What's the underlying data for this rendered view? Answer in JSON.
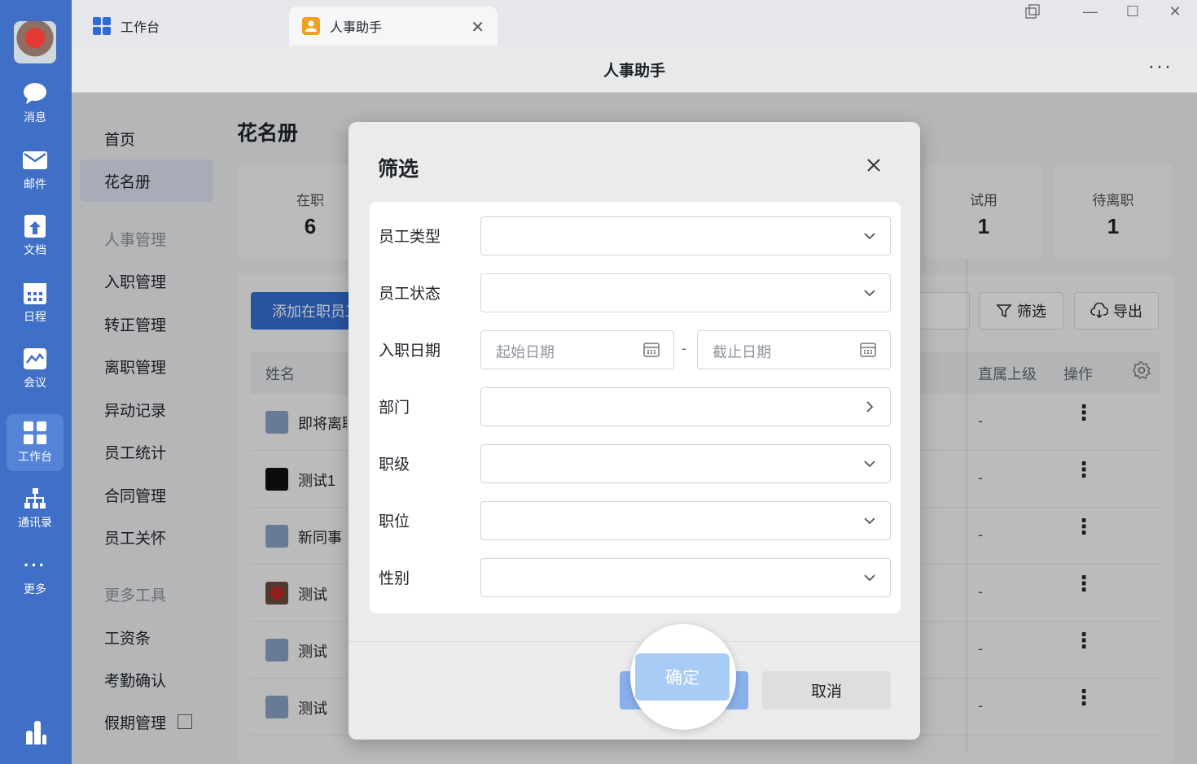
{
  "rail": {
    "items": [
      {
        "label": "消息",
        "icon": "chat-icon"
      },
      {
        "label": "邮件",
        "icon": "mail-icon"
      },
      {
        "label": "文档",
        "icon": "docs-icon"
      },
      {
        "label": "日程",
        "icon": "calendar-icon"
      },
      {
        "label": "会议",
        "icon": "meeting-icon"
      },
      {
        "label": "工作台",
        "icon": "workbench-icon",
        "active": true
      },
      {
        "label": "通讯录",
        "icon": "contacts-icon"
      },
      {
        "label": "更多",
        "icon": "more-icon"
      }
    ]
  },
  "tabs": {
    "tab1": "工作台",
    "tab2": "人事助手",
    "close": "✕"
  },
  "window": {
    "minimize": "—",
    "maximize": "☐",
    "close": "✕"
  },
  "header": {
    "title": "人事助手",
    "more": "···"
  },
  "sidenav": {
    "home": "首页",
    "roster": "花名册",
    "hr_group": "人事管理",
    "onboarding": "入职管理",
    "regularization": "转正管理",
    "offboarding": "离职管理",
    "changes": "异动记录",
    "stats": "员工统计",
    "contracts": "合同管理",
    "care": "员工关怀",
    "tools_group": "更多工具",
    "payslip": "工资条",
    "attendance": "考勤确认",
    "leave": "假期管理"
  },
  "main": {
    "title": "花名册",
    "stats": [
      {
        "label": "在职",
        "value": "6"
      },
      {
        "label": "试用",
        "value": "1"
      },
      {
        "label": "待离职",
        "value": "1"
      }
    ],
    "add_button": "添加在职员工",
    "filter_button": "筛选",
    "export_button": "导出",
    "columns": {
      "name": "姓名",
      "supervisor": "直属上级",
      "ops": "操作"
    },
    "rows": [
      {
        "name": "即将离职",
        "supervisor": "-",
        "ops": "⋮"
      },
      {
        "name": "测试1",
        "supervisor": "-",
        "ops": "⋮"
      },
      {
        "name": "新同事",
        "supervisor": "-",
        "ops": "⋮"
      },
      {
        "name": "测试",
        "supervisor": "-",
        "ops": "⋮"
      },
      {
        "name": "测试",
        "supervisor": "-",
        "ops": "⋮"
      },
      {
        "name": "测试",
        "supervisor": "-",
        "ops": "⋮"
      }
    ]
  },
  "dialog": {
    "title": "筛选",
    "fields": {
      "employee_type": "员工类型",
      "employee_status": "员工状态",
      "hire_date": "入职日期",
      "department": "部门",
      "rank": "职级",
      "position": "职位",
      "gender": "性别"
    },
    "start_date_placeholder": "起始日期",
    "end_date_placeholder": "截止日期",
    "date_separator": "-",
    "confirm": "确定",
    "cancel": "取消"
  }
}
